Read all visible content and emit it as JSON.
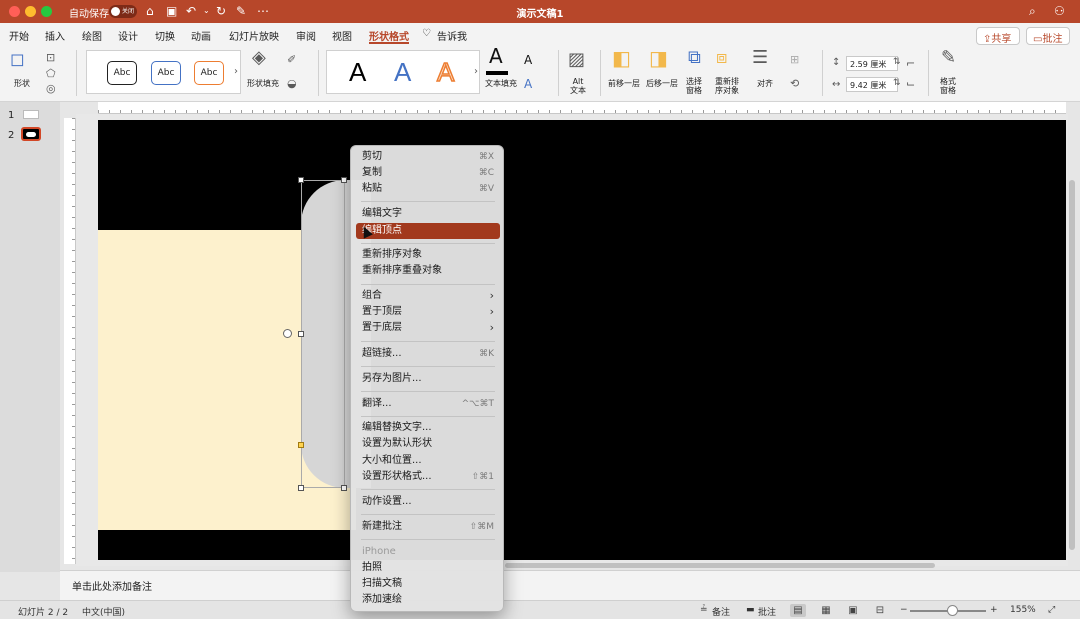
{
  "titlebar": {
    "autosave_label": "自动保存",
    "autosave_state": "关闭",
    "doc_title": "演示文稿1",
    "icons": [
      "home-icon",
      "save-icon",
      "undo-icon",
      "redo-icon",
      "edit-icon",
      "more-icon",
      "search-icon",
      "account-icon"
    ]
  },
  "tabs": [
    "开始",
    "插入",
    "绘图",
    "设计",
    "切换",
    "动画",
    "幻灯片放映",
    "审阅",
    "视图",
    "形状格式"
  ],
  "tell_me": "告诉我",
  "share_label": "共享",
  "comment_label": "批注",
  "ribbon": {
    "shape_label": "形状",
    "abc": [
      "Abc",
      "Abc",
      "Abc"
    ],
    "shape_fill_label": "形状填充",
    "wordart": [
      "A",
      "A",
      "A"
    ],
    "text_fill_label": "文本填充",
    "alt_text_label": "Alt\n文本",
    "bring_forward_label": "前移一层",
    "send_backward_label": "后移一层",
    "selection_pane_label": "选择\n窗格",
    "reorder_label": "重新排\n序对象",
    "align_label": "对齐",
    "height_value": "2.59 厘米",
    "width_value": "9.42 厘米",
    "format_pane_label": "格式\n窗格",
    "accent_color": "#b7472a"
  },
  "thumbnails": [
    "1",
    "2"
  ],
  "context_menu": {
    "items": [
      {
        "label": "剪切",
        "shortcut": "⌘X"
      },
      {
        "label": "复制",
        "shortcut": "⌘C"
      },
      {
        "label": "粘贴",
        "shortcut": "⌘V"
      },
      {
        "label": "编辑文字",
        "shortcut": ""
      },
      {
        "label": "编辑顶点",
        "shortcut": ""
      },
      {
        "label": "重新排序对象",
        "shortcut": ""
      },
      {
        "label": "重新排序重叠对象",
        "shortcut": ""
      },
      {
        "label": "组合",
        "shortcut": ""
      },
      {
        "label": "置于顶层",
        "shortcut": ""
      },
      {
        "label": "置于底层",
        "shortcut": ""
      },
      {
        "label": "超链接...",
        "shortcut": "⌘K"
      },
      {
        "label": "另存为图片...",
        "shortcut": ""
      },
      {
        "label": "翻译...",
        "shortcut": "^⌥⌘T"
      },
      {
        "label": "编辑替换文字...",
        "shortcut": ""
      },
      {
        "label": "设置为默认形状",
        "shortcut": ""
      },
      {
        "label": "大小和位置...",
        "shortcut": ""
      },
      {
        "label": "设置形状格式...",
        "shortcut": "⇧⌘1"
      },
      {
        "label": "动作设置...",
        "shortcut": ""
      },
      {
        "label": "新建批注",
        "shortcut": "⇧⌘M"
      },
      {
        "label": "iPhone",
        "shortcut": ""
      },
      {
        "label": "拍照",
        "shortcut": ""
      },
      {
        "label": "扫描文稿",
        "shortcut": ""
      },
      {
        "label": "添加速绘",
        "shortcut": ""
      }
    ]
  },
  "notes_placeholder": "单击此处添加备注",
  "status": {
    "slide_info": "幻灯片 2 / 2",
    "language": "中文(中国)",
    "notes_label": "备注",
    "comments_label": "批注",
    "zoom_minus": "−",
    "zoom_plus": "+",
    "zoom": "155%"
  }
}
